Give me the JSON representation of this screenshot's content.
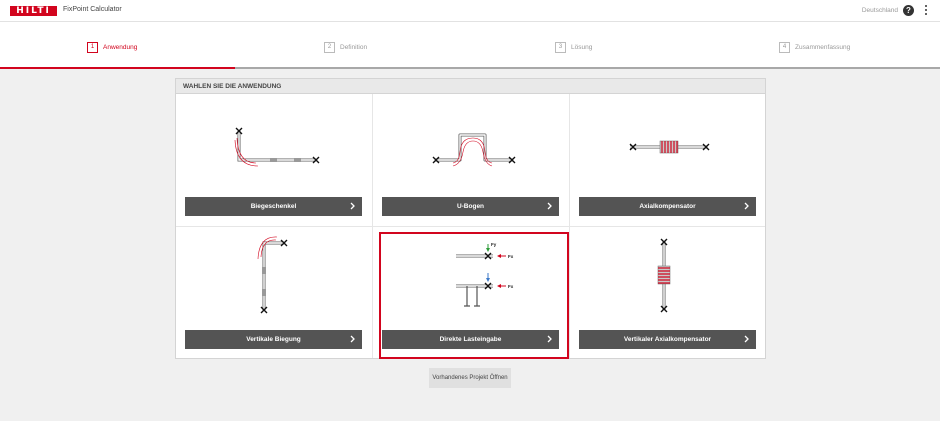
{
  "header": {
    "logo_text": "HILTI",
    "app_title": "FixPoint Calculator",
    "language": "Deutschland",
    "help_glyph": "?",
    "help_icon": "help-icon",
    "menu_icon": "more-vertical-icon",
    "brand_color": "#d2051e"
  },
  "steps": [
    {
      "num": "1",
      "label": "Anwendung",
      "active": true
    },
    {
      "num": "2",
      "label": "Definition",
      "active": false
    },
    {
      "num": "3",
      "label": "Lösung",
      "active": false
    },
    {
      "num": "4",
      "label": "Zusammenfassung",
      "active": false
    }
  ],
  "panel": {
    "title": "WAHLEN SIE DIE ANWENDUNG",
    "cards": [
      {
        "label": "Biegeschenkel"
      },
      {
        "label": "U-Bogen"
      },
      {
        "label": "Axialkompensator"
      },
      {
        "label": "Vertikale Biegung"
      },
      {
        "label": "Direkte Lasteingabe",
        "selected": true
      },
      {
        "label": "Vertikaler Axialkompensator"
      }
    ]
  },
  "diagram_labels": {
    "fy": "Fy",
    "fx": "Fx"
  },
  "open_project_label": "Vorhandenes Projekt Öffnen"
}
